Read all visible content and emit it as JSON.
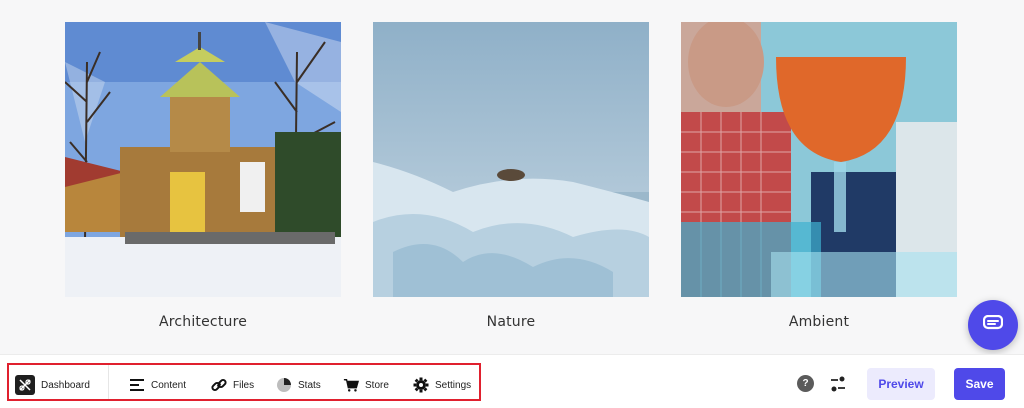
{
  "gallery": {
    "items": [
      {
        "caption": "Architecture",
        "image": "wooden-church-in-snow"
      },
      {
        "caption": "Nature",
        "image": "frozen-ice-shore"
      },
      {
        "caption": "Ambient",
        "image": "cocktail-glass-people"
      }
    ]
  },
  "chat": {
    "icon": "chat-bubble-icon"
  },
  "toolbar": {
    "nav": [
      {
        "label": "Dashboard",
        "icon": "logo-icon"
      },
      {
        "label": "Content",
        "icon": "content-lines-icon"
      },
      {
        "label": "Files",
        "icon": "link-icon"
      },
      {
        "label": "Stats",
        "icon": "pie-chart-icon"
      },
      {
        "label": "Store",
        "icon": "cart-icon"
      },
      {
        "label": "Settings",
        "icon": "gear-icon"
      }
    ],
    "help_label": "?",
    "preview_label": "Preview",
    "save_label": "Save"
  },
  "colors": {
    "accent": "#4f49e9",
    "accent_light": "#ecebfd",
    "highlight_border": "#e0202e"
  }
}
